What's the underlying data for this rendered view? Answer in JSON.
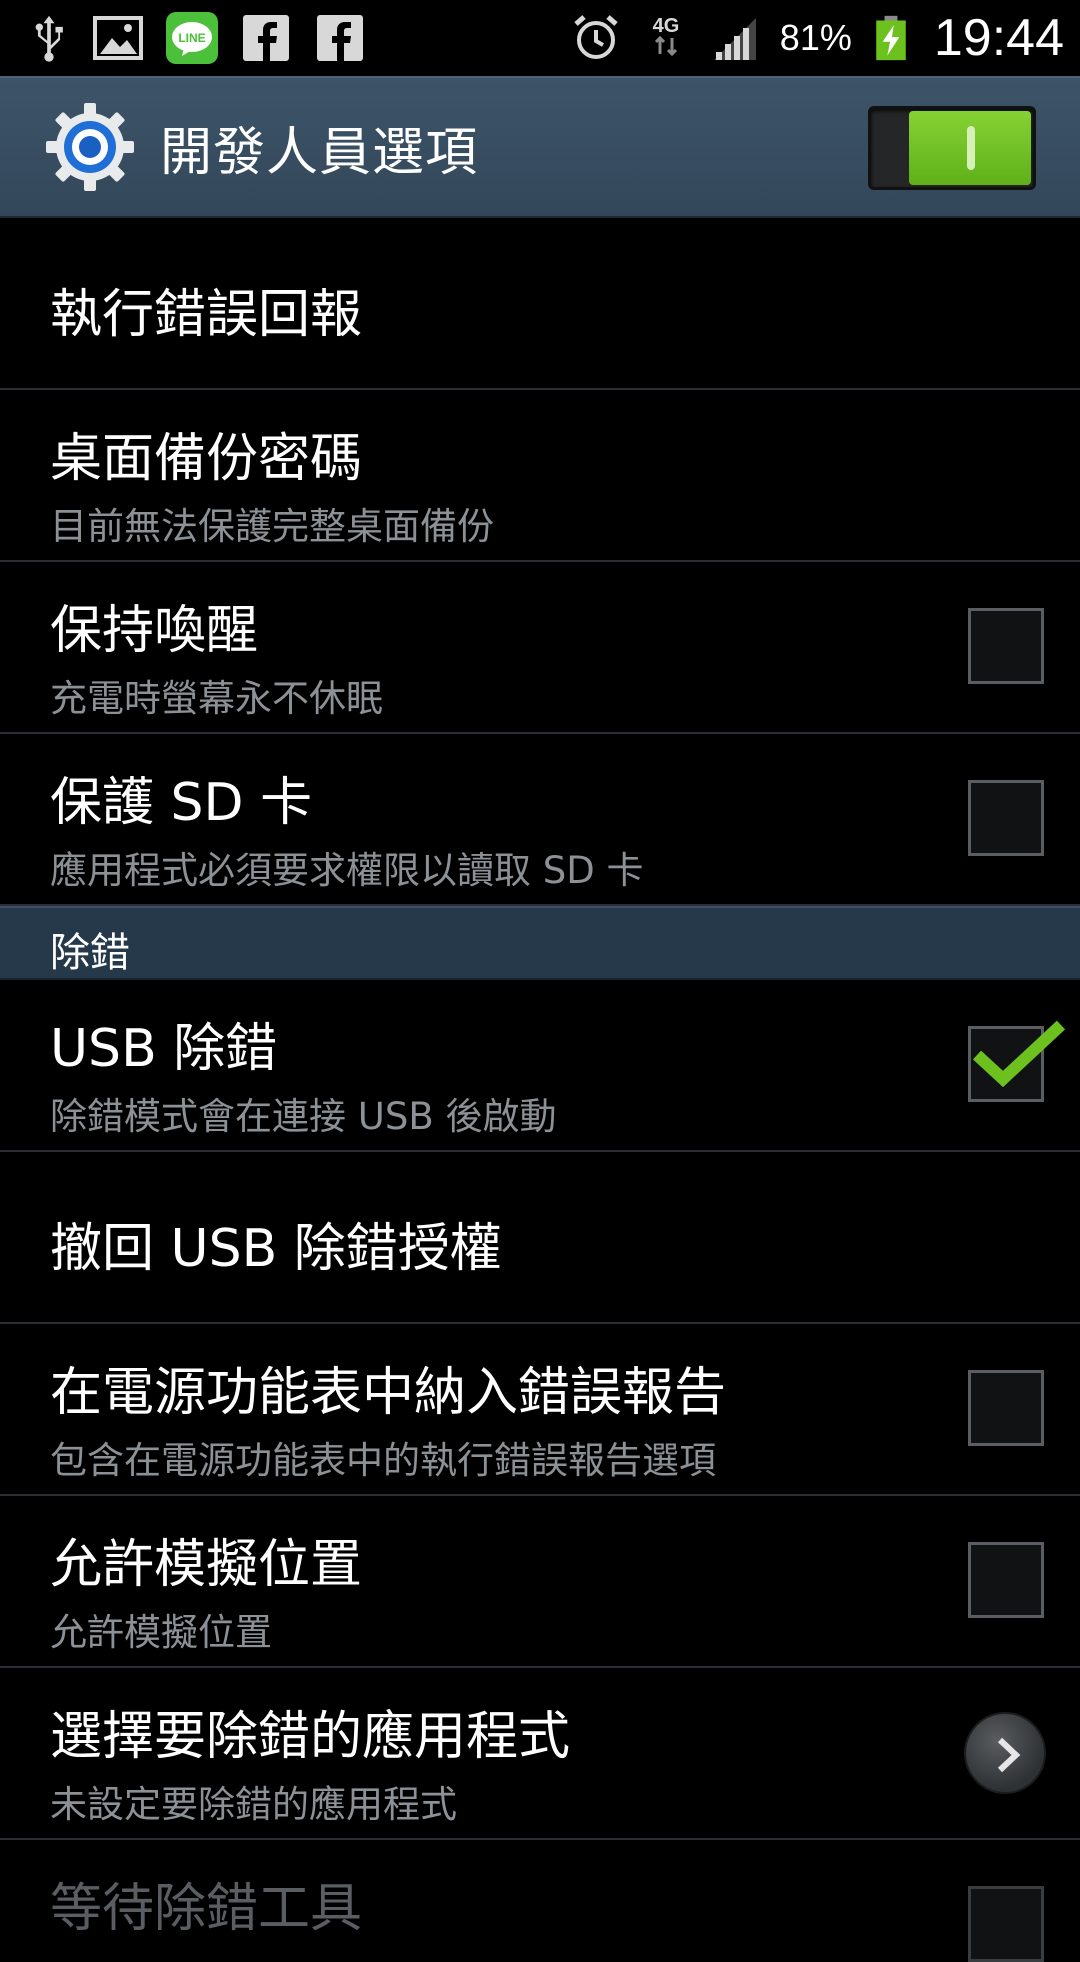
{
  "status_bar": {
    "battery_percent": "81%",
    "network_type": "4G",
    "time": "19:44"
  },
  "action_bar": {
    "title": "開發人員選項",
    "master_toggle_on": true
  },
  "list": {
    "take_bug_report": {
      "title": "執行錯誤回報"
    },
    "desktop_backup_password": {
      "title": "桌面備份密碼",
      "summary": "目前無法保護完整桌面備份"
    },
    "stay_awake": {
      "title": "保持喚醒",
      "summary": "充電時螢幕永不休眠",
      "checked": false
    },
    "protect_sd": {
      "title": "保護 SD 卡",
      "summary": "應用程式必須要求權限以讀取 SD 卡",
      "checked": false
    },
    "section_debugging": {
      "label": "除錯"
    },
    "usb_debugging": {
      "title": "USB 除錯",
      "summary": "除錯模式會在連接 USB 後啟動",
      "checked": true
    },
    "revoke_usb_auth": {
      "title": "撤回 USB 除錯授權"
    },
    "bug_report_in_power_menu": {
      "title": "在電源功能表中納入錯誤報告",
      "summary": "包含在電源功能表中的執行錯誤報告選項",
      "checked": false
    },
    "mock_locations": {
      "title": "允許模擬位置",
      "summary": "允許模擬位置",
      "checked": false
    },
    "select_debug_app": {
      "title": "選擇要除錯的應用程式",
      "summary": "未設定要除錯的應用程式"
    },
    "wait_for_debugger": {
      "title": "等待除錯工具"
    }
  },
  "colors": {
    "accent_green": "#6cc11f",
    "action_bar_bg": "#3a4f63",
    "section_bg": "#26394b",
    "summary_text": "#8c9196"
  }
}
